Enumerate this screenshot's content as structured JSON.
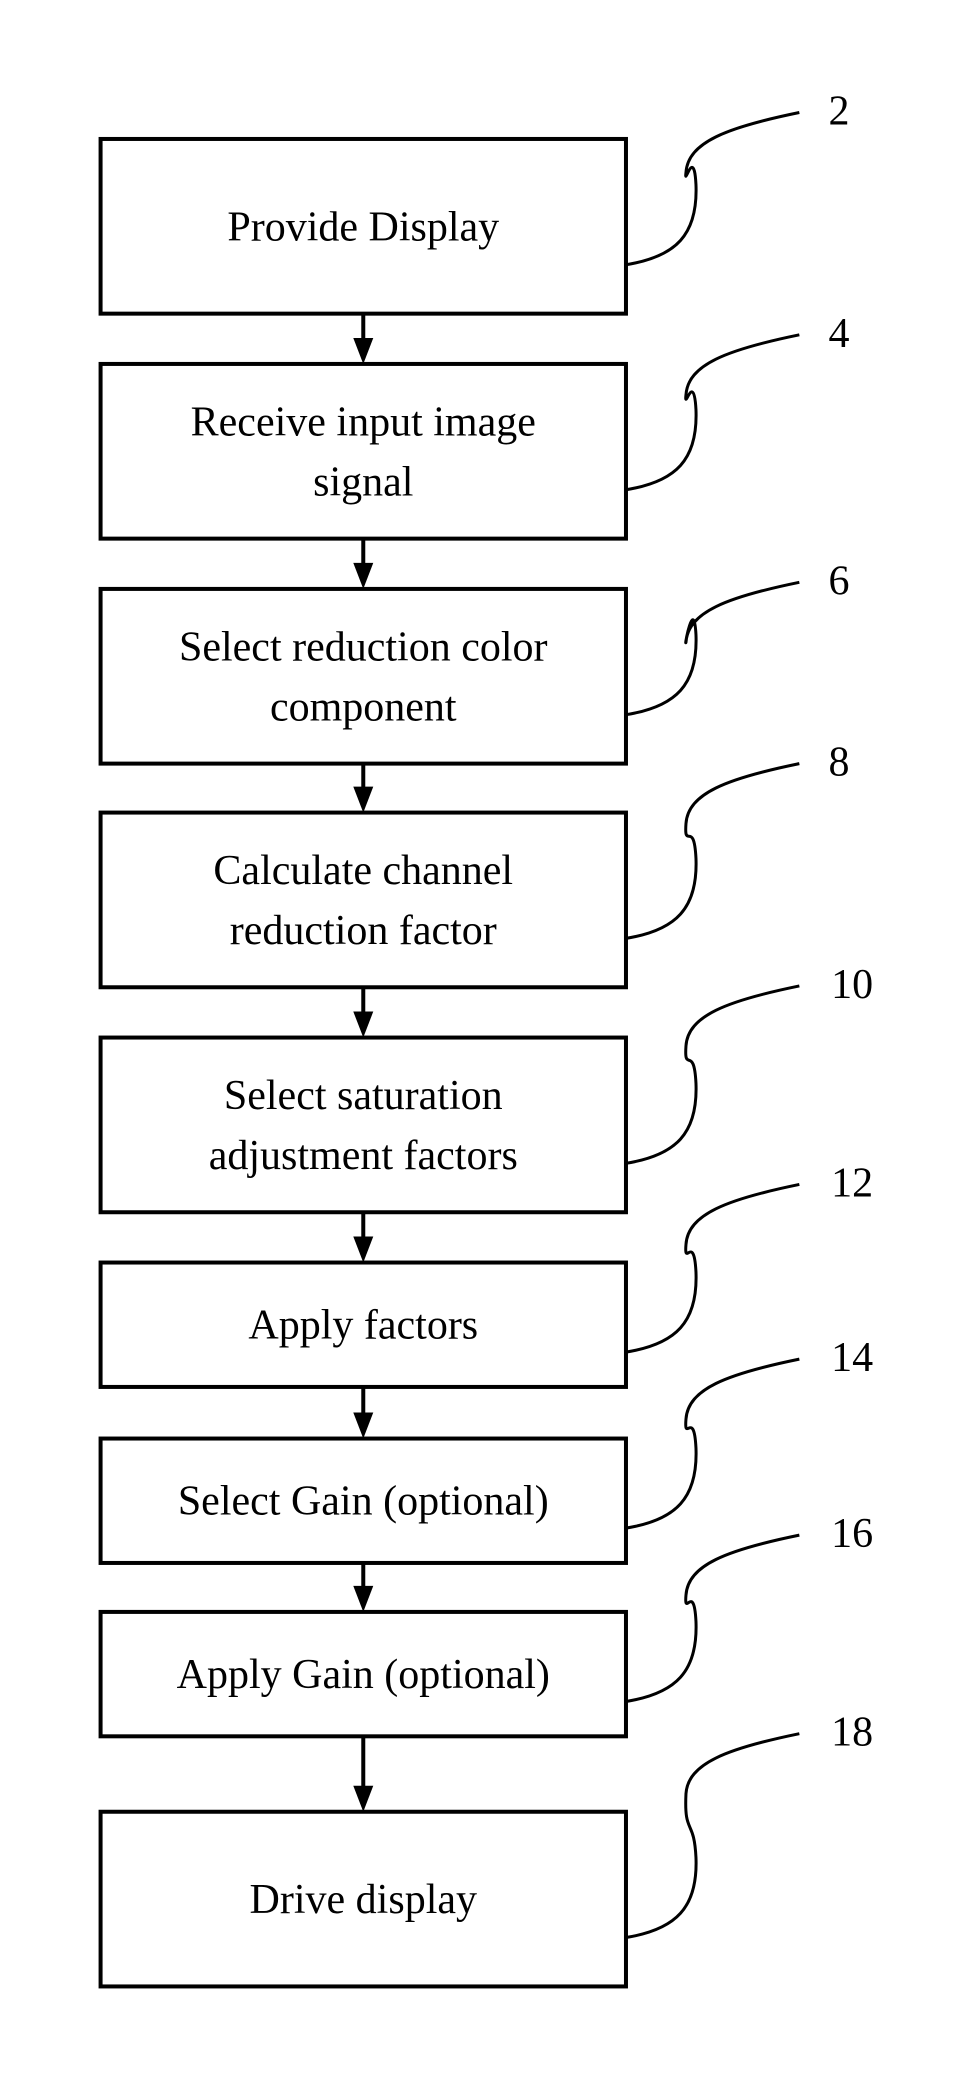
{
  "diagram": {
    "type": "flowchart",
    "direction": "top-to-bottom",
    "steps": [
      {
        "ref": "2",
        "lines": [
          "Provide Display"
        ]
      },
      {
        "ref": "4",
        "lines": [
          "Receive input image",
          "signal"
        ]
      },
      {
        "ref": "6",
        "lines": [
          "Select reduction color",
          "component"
        ]
      },
      {
        "ref": "8",
        "lines": [
          "Calculate channel",
          "reduction factor"
        ]
      },
      {
        "ref": "10",
        "lines": [
          "Select saturation",
          "adjustment factors"
        ]
      },
      {
        "ref": "12",
        "lines": [
          "Apply factors"
        ]
      },
      {
        "ref": "14",
        "lines": [
          "Select Gain (optional)"
        ]
      },
      {
        "ref": "16",
        "lines": [
          "Apply Gain (optional)"
        ]
      },
      {
        "ref": "18",
        "lines": [
          "Drive display"
        ]
      }
    ]
  }
}
